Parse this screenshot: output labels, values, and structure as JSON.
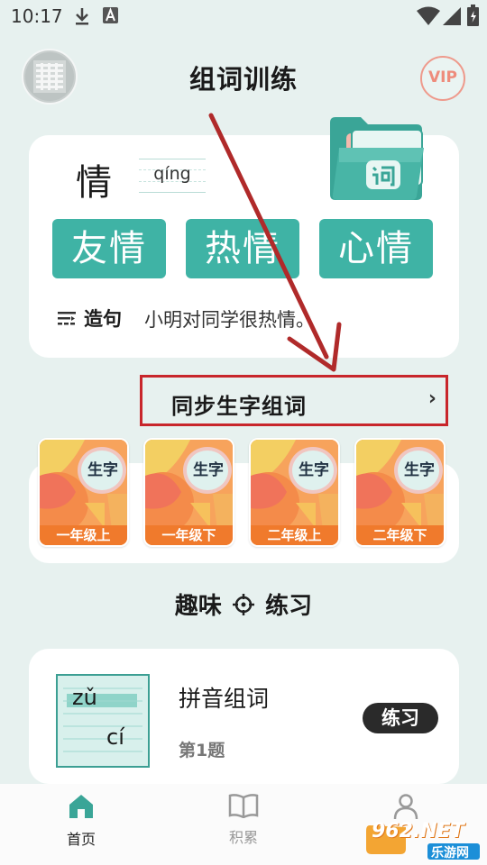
{
  "status_bar": {
    "time": "10:17"
  },
  "header": {
    "title": "组词训练",
    "vip_label": "VIP"
  },
  "word_card": {
    "character": "情",
    "pinyin": "qíng",
    "words": [
      "友情",
      "热情",
      "心情"
    ],
    "sentence_label": "造句",
    "sentence": "小明对同学很热情。"
  },
  "sync_section": {
    "label": "同步生字组词",
    "chevron": "›"
  },
  "grades": [
    {
      "badge": "生字",
      "label": "一年级上"
    },
    {
      "badge": "生字",
      "label": "一年级下"
    },
    {
      "badge": "生字",
      "label": "二年级上"
    },
    {
      "badge": "生字",
      "label": "二年级下"
    }
  ],
  "fun_section": {
    "title_left": "趣味",
    "title_right": "练习"
  },
  "pinyin_card": {
    "thumb_line1": "zǔ",
    "thumb_line2": "cí",
    "title": "拼音组词",
    "subtitle": "第1题",
    "button": "练习"
  },
  "bottom_nav": {
    "items": [
      {
        "label": "首页",
        "icon": "home-icon",
        "active": true
      },
      {
        "label": "积累",
        "icon": "book-icon",
        "active": false
      },
      {
        "label": "",
        "icon": "person-icon",
        "active": false
      }
    ]
  },
  "watermark": {
    "text1": "962.NET",
    "text2": "乐游网"
  },
  "colors": {
    "accent": "#3fb3a5",
    "highlight_border": "#c8262b",
    "arrow": "#b02a2a",
    "grade_orange": "#f07a2c"
  }
}
